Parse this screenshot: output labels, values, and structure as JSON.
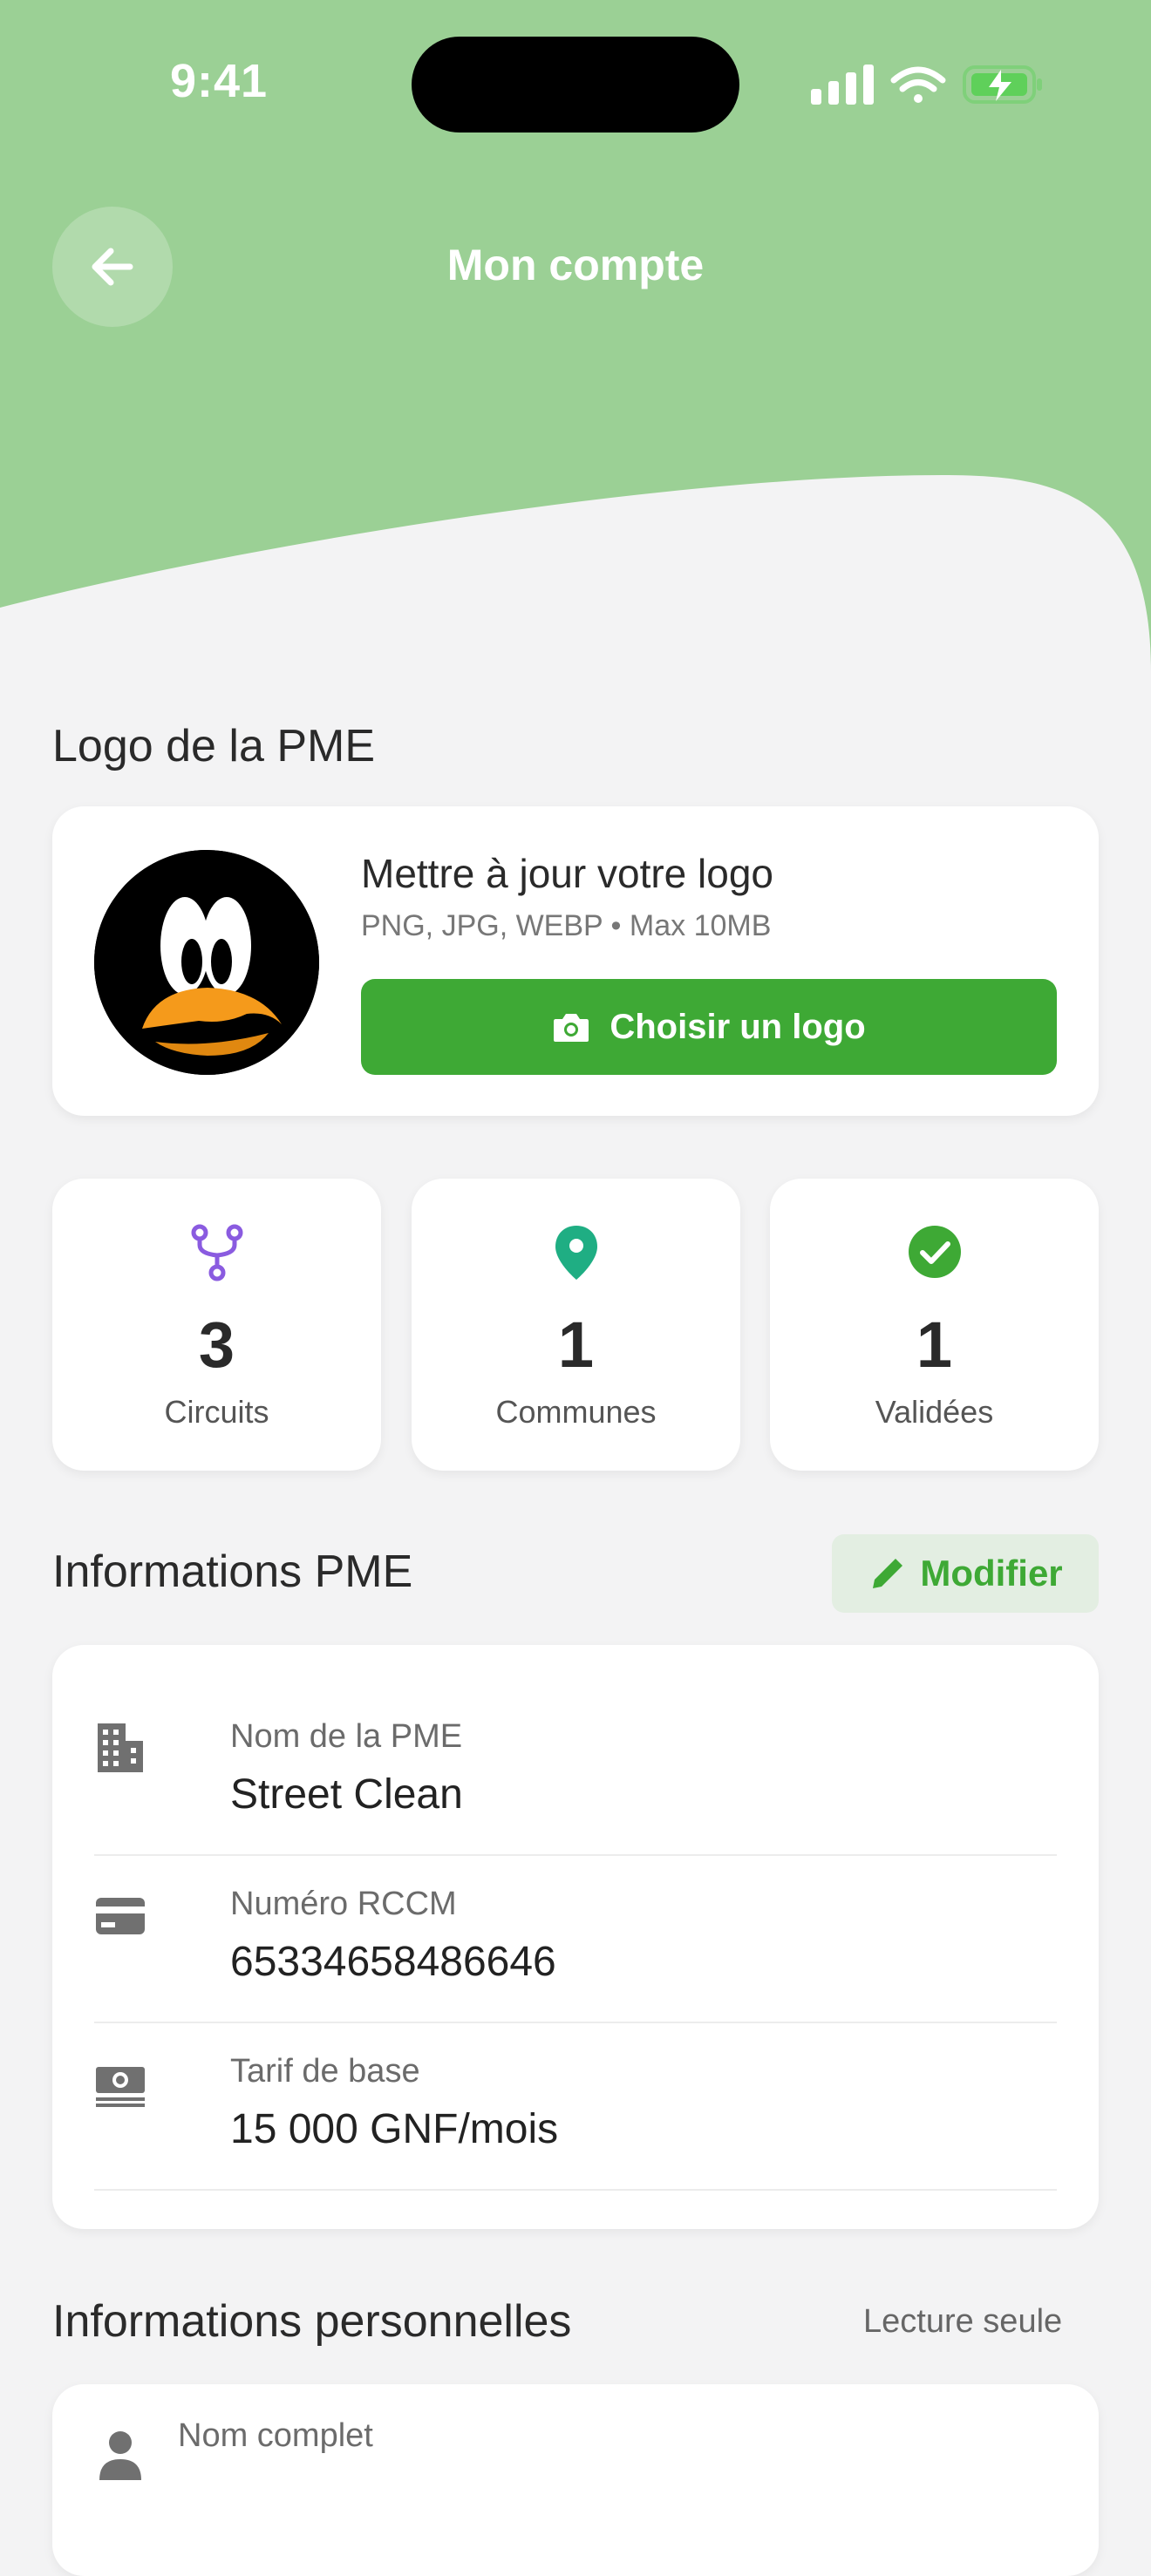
{
  "status_bar": {
    "time": "9:41"
  },
  "header": {
    "title": "Mon compte"
  },
  "logo_section": {
    "title": "Logo de la PME",
    "heading": "Mettre à jour votre logo",
    "subtitle": "PNG, JPG, WEBP • Max 10MB",
    "button_label": "Choisir un logo"
  },
  "stats": [
    {
      "value": "3",
      "label": "Circuits",
      "icon": "route-icon",
      "color": "#8a5be0"
    },
    {
      "value": "1",
      "label": "Communes",
      "icon": "location-pin-icon",
      "color": "#1fae83"
    },
    {
      "value": "1",
      "label": "Validées",
      "icon": "check-circle-icon",
      "color": "#3ea935"
    }
  ],
  "pme_info": {
    "title": "Informations PME",
    "edit_label": "Modifier",
    "rows": [
      {
        "key": "Nom de la PME",
        "value": "Street Clean",
        "icon": "building-icon"
      },
      {
        "key": "Numéro RCCM",
        "value": "65334658486646",
        "icon": "card-icon"
      },
      {
        "key": "Tarif de base",
        "value": "15 000 GNF/mois",
        "icon": "money-icon"
      }
    ]
  },
  "personal_info": {
    "title": "Informations personnelles",
    "badge": "Lecture seule",
    "rows": [
      {
        "key": "Nom complet",
        "icon": "person-icon"
      }
    ]
  },
  "colors": {
    "header_green": "#9bd095",
    "primary_green": "#3ea935",
    "background": "#f3f3f4"
  }
}
